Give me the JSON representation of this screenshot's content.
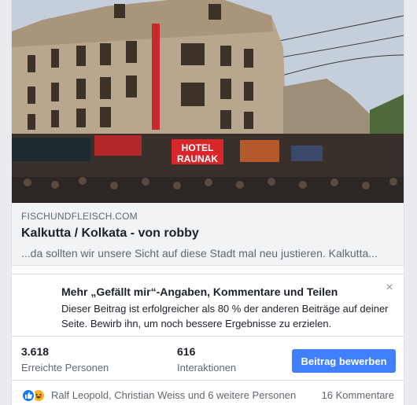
{
  "link_preview": {
    "domain": "FISCHUNDFLEISCH.COM",
    "title": "Kalkutta / Kolkata - von robby",
    "description": "...da sollten wir unsere Sicht auf diese Stadt mal neu justieren. Kalkutta..."
  },
  "photo": {
    "hotel_sign_line1": "HOTEL",
    "hotel_sign_line2": "RAUNAK"
  },
  "boost_panel": {
    "heading": "Mehr „Gefällt mir“-Angaben, Kommentare und Teilen",
    "body": "Dieser Beitrag ist erfolgreicher als 80 % der anderen Beiträge auf deiner Seite. Bewirb ihn, um noch bessere Ergebnisse zu erzielen.",
    "close_icon": "close-icon"
  },
  "stats": {
    "reach_value": "3.618",
    "reach_label": "Erreichte Personen",
    "interactions_value": "616",
    "interactions_label": "Interaktionen",
    "boost_button": "Beitrag bewerben"
  },
  "reactions": {
    "icons": [
      "like-icon",
      "haha-icon"
    ],
    "names": "Ralf Leopold, Christian Weiss und 6 weitere Personen",
    "comments": "16 Kommentare"
  },
  "colors": {
    "accent": "#4080ff",
    "page_bg": "#e9ebee",
    "preview_bg": "#f2f3f5"
  }
}
